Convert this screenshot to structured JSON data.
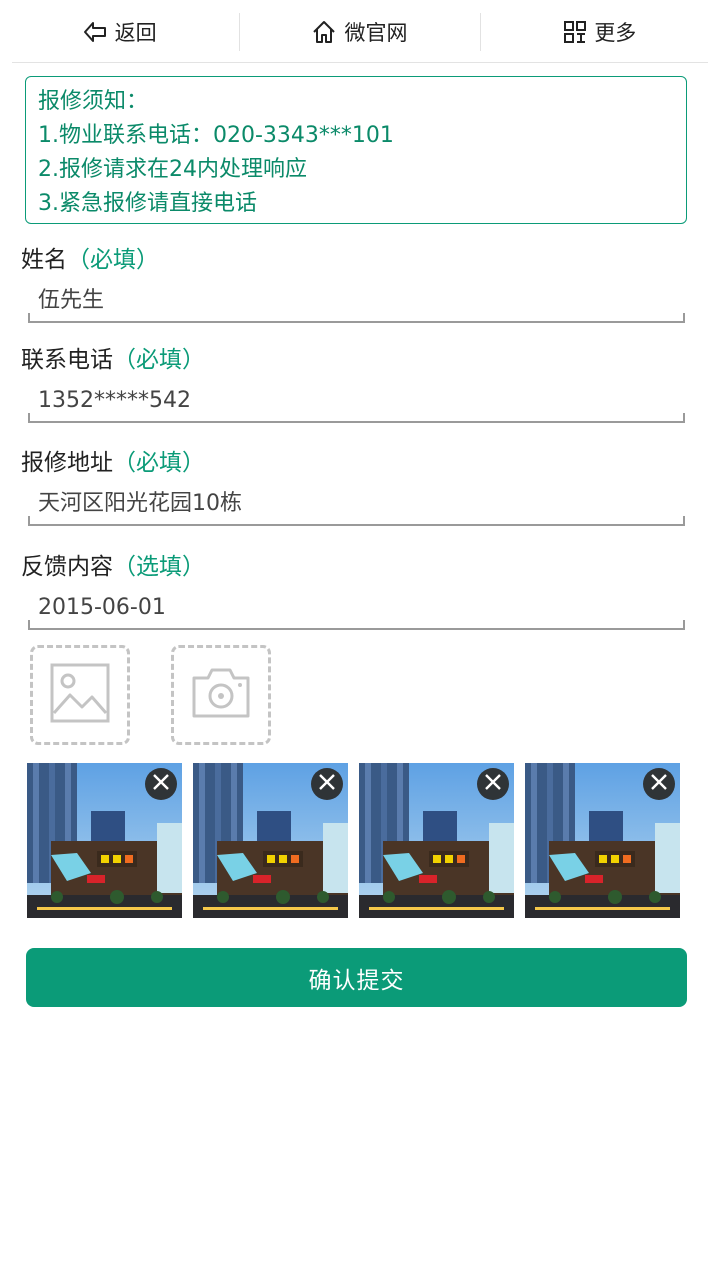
{
  "nav": {
    "back_label": "返回",
    "home_label": "微官网",
    "more_label": "更多",
    "icons": [
      "back-arrow-icon",
      "home-icon",
      "grid-menu-icon"
    ]
  },
  "notice": {
    "lines": [
      "报修须知：",
      "1.物业联系电话：020-3343***101",
      "2.报修请求在24内处理响应",
      "3.紧急报修请直接电话"
    ]
  },
  "form": {
    "name": {
      "label": "姓名",
      "tag": "（必填）",
      "value": "伍先生"
    },
    "phone": {
      "label": "联系电话",
      "tag": "（必填）",
      "value": "1352*****542"
    },
    "address": {
      "label": "报修地址",
      "tag": "（必填）",
      "value": "天河区阳光花园10栋"
    },
    "feedback": {
      "label": "反馈内容",
      "tag": "（选填）",
      "value": "2015-06-01"
    }
  },
  "upload": {
    "icons": [
      "image-placeholder-icon",
      "camera-icon"
    ]
  },
  "photos": {
    "count": 4,
    "delete_icon": "close-circle-icon"
  },
  "submit": {
    "label": "确认提交"
  },
  "colors": {
    "accent": "#0b9b78",
    "accent_text": "#0b8a69",
    "delete_bg": "#2f3437",
    "placeholder": "#c4c4c4"
  }
}
